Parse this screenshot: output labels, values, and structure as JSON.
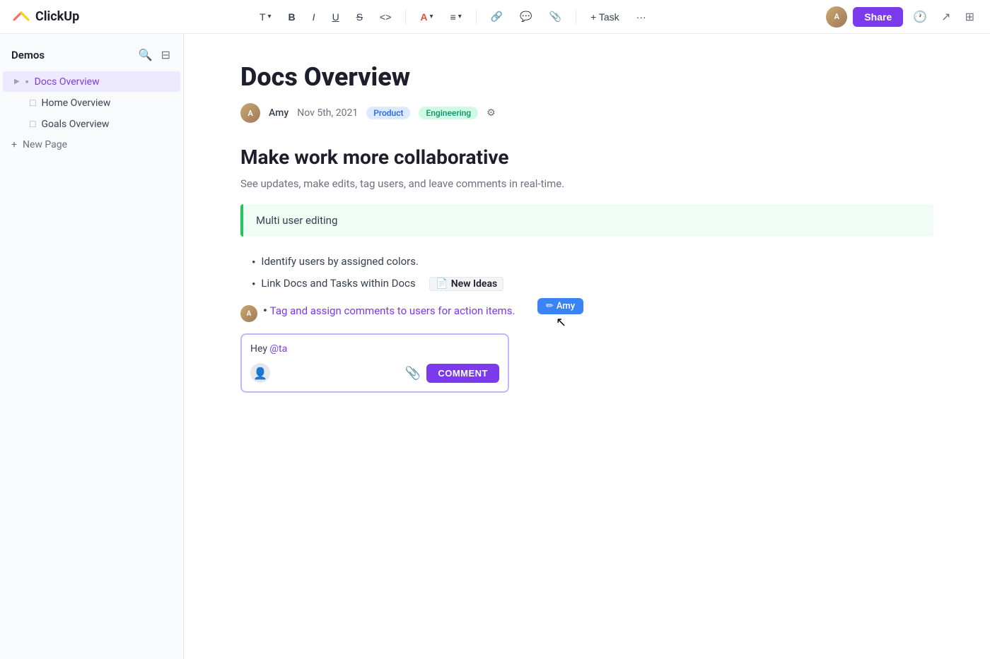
{
  "app": {
    "name": "ClickUp"
  },
  "toolbar": {
    "text_btn": "T",
    "bold_btn": "B",
    "italic_btn": "I",
    "underline_btn": "U",
    "strikethrough_btn": "S",
    "code_btn": "<>",
    "color_btn": "A",
    "align_btn": "≡",
    "link_btn": "🔗",
    "comment_btn": "💬",
    "attach_btn": "📎",
    "task_btn": "+ Task",
    "more_btn": "···",
    "share_btn": "Share",
    "history_icon": "clock",
    "expand_icon": "expand",
    "layout_icon": "layout"
  },
  "sidebar": {
    "title": "Demos",
    "search_icon": "search",
    "collapse_icon": "collapse",
    "items": [
      {
        "label": "Docs Overview",
        "icon": "■",
        "active": true,
        "has_arrow": true
      },
      {
        "label": "Home Overview",
        "icon": "□",
        "active": false
      },
      {
        "label": "Goals Overview",
        "icon": "□",
        "active": false
      }
    ],
    "new_page_label": "New Page"
  },
  "document": {
    "title": "Docs Overview",
    "author": "Amy",
    "date": "Nov 5th, 2021",
    "tags": [
      "Product",
      "Engineering"
    ],
    "heading": "Make work more collaborative",
    "subheading": "See updates, make edits, tag users, and leave comments in real-time.",
    "callout": "Multi user editing",
    "bullets": [
      "Identify users by assigned colors.",
      "Link Docs and Tasks within Docs"
    ],
    "doc_link_label": "New Ideas",
    "tagged_bullet": "Tag and assign comments to users for action items.",
    "amy_tooltip": "Amy",
    "comment_text": "Hey @ta",
    "comment_btn": "COMMENT"
  }
}
